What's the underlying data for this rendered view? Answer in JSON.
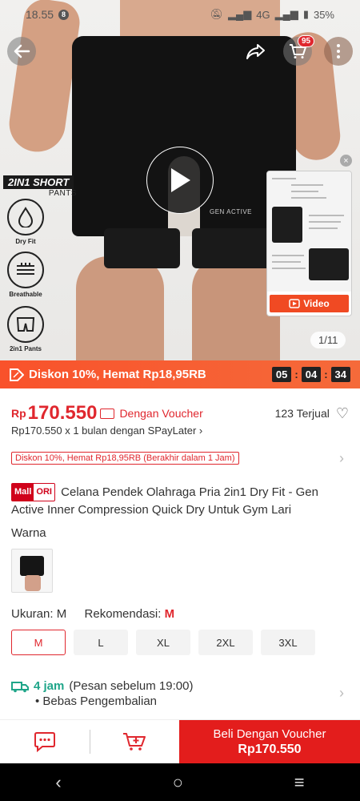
{
  "status": {
    "time": "18.55",
    "notif_badge": "8",
    "network": "4G",
    "battery": "35%"
  },
  "hero": {
    "tag_2in1": "2IN1 SHORT",
    "tag_pants": "PANTS",
    "features": [
      "Dry Fit",
      "Breathable",
      "2in1 Pants"
    ],
    "shorts_logo": "GEN ACTIVE",
    "cart_count": "95",
    "video_label": "Video",
    "image_counter": "1/11"
  },
  "discount_bar": {
    "text": "Diskon 10%, Hemat Rp18,95RB",
    "timer": [
      "05",
      "04",
      "34"
    ]
  },
  "price": {
    "currency": "Rp",
    "value": "170.550",
    "voucher_label": "Dengan Voucher",
    "sold": "123 Terjual",
    "spaylater": "Rp170.550 x 1 bulan dengan SPayLater",
    "promo_chip": "Diskon 10%, Hemat Rp18,95RB (Berakhir dalam 1 Jam)"
  },
  "product": {
    "mall_badge_1": "Mall",
    "mall_badge_2": "ORI",
    "title": "Celana Pendek Olahraga Pria 2in1 Dry Fit - Gen Active Inner Compression Quick Dry Untuk Gym Lari"
  },
  "variant": {
    "color_label": "Warna",
    "size_label": "Ukuran:",
    "size_selected": "M",
    "recommend_label": "Rekomendasi:",
    "recommend_value": "M",
    "sizes": [
      "M",
      "L",
      "XL",
      "2XL",
      "3XL"
    ]
  },
  "shipping": {
    "time": "4 jam",
    "note": "(Pesan sebelum 19:00)",
    "returns": "• Bebas Pengembalian"
  },
  "bottom_bar": {
    "buy_line1": "Beli Dengan Voucher",
    "buy_line2": "Rp170.550"
  },
  "colors": {
    "brand_red": "#e0272e",
    "discount_orange": "#f9522b",
    "ship_green": "#1fa589"
  }
}
